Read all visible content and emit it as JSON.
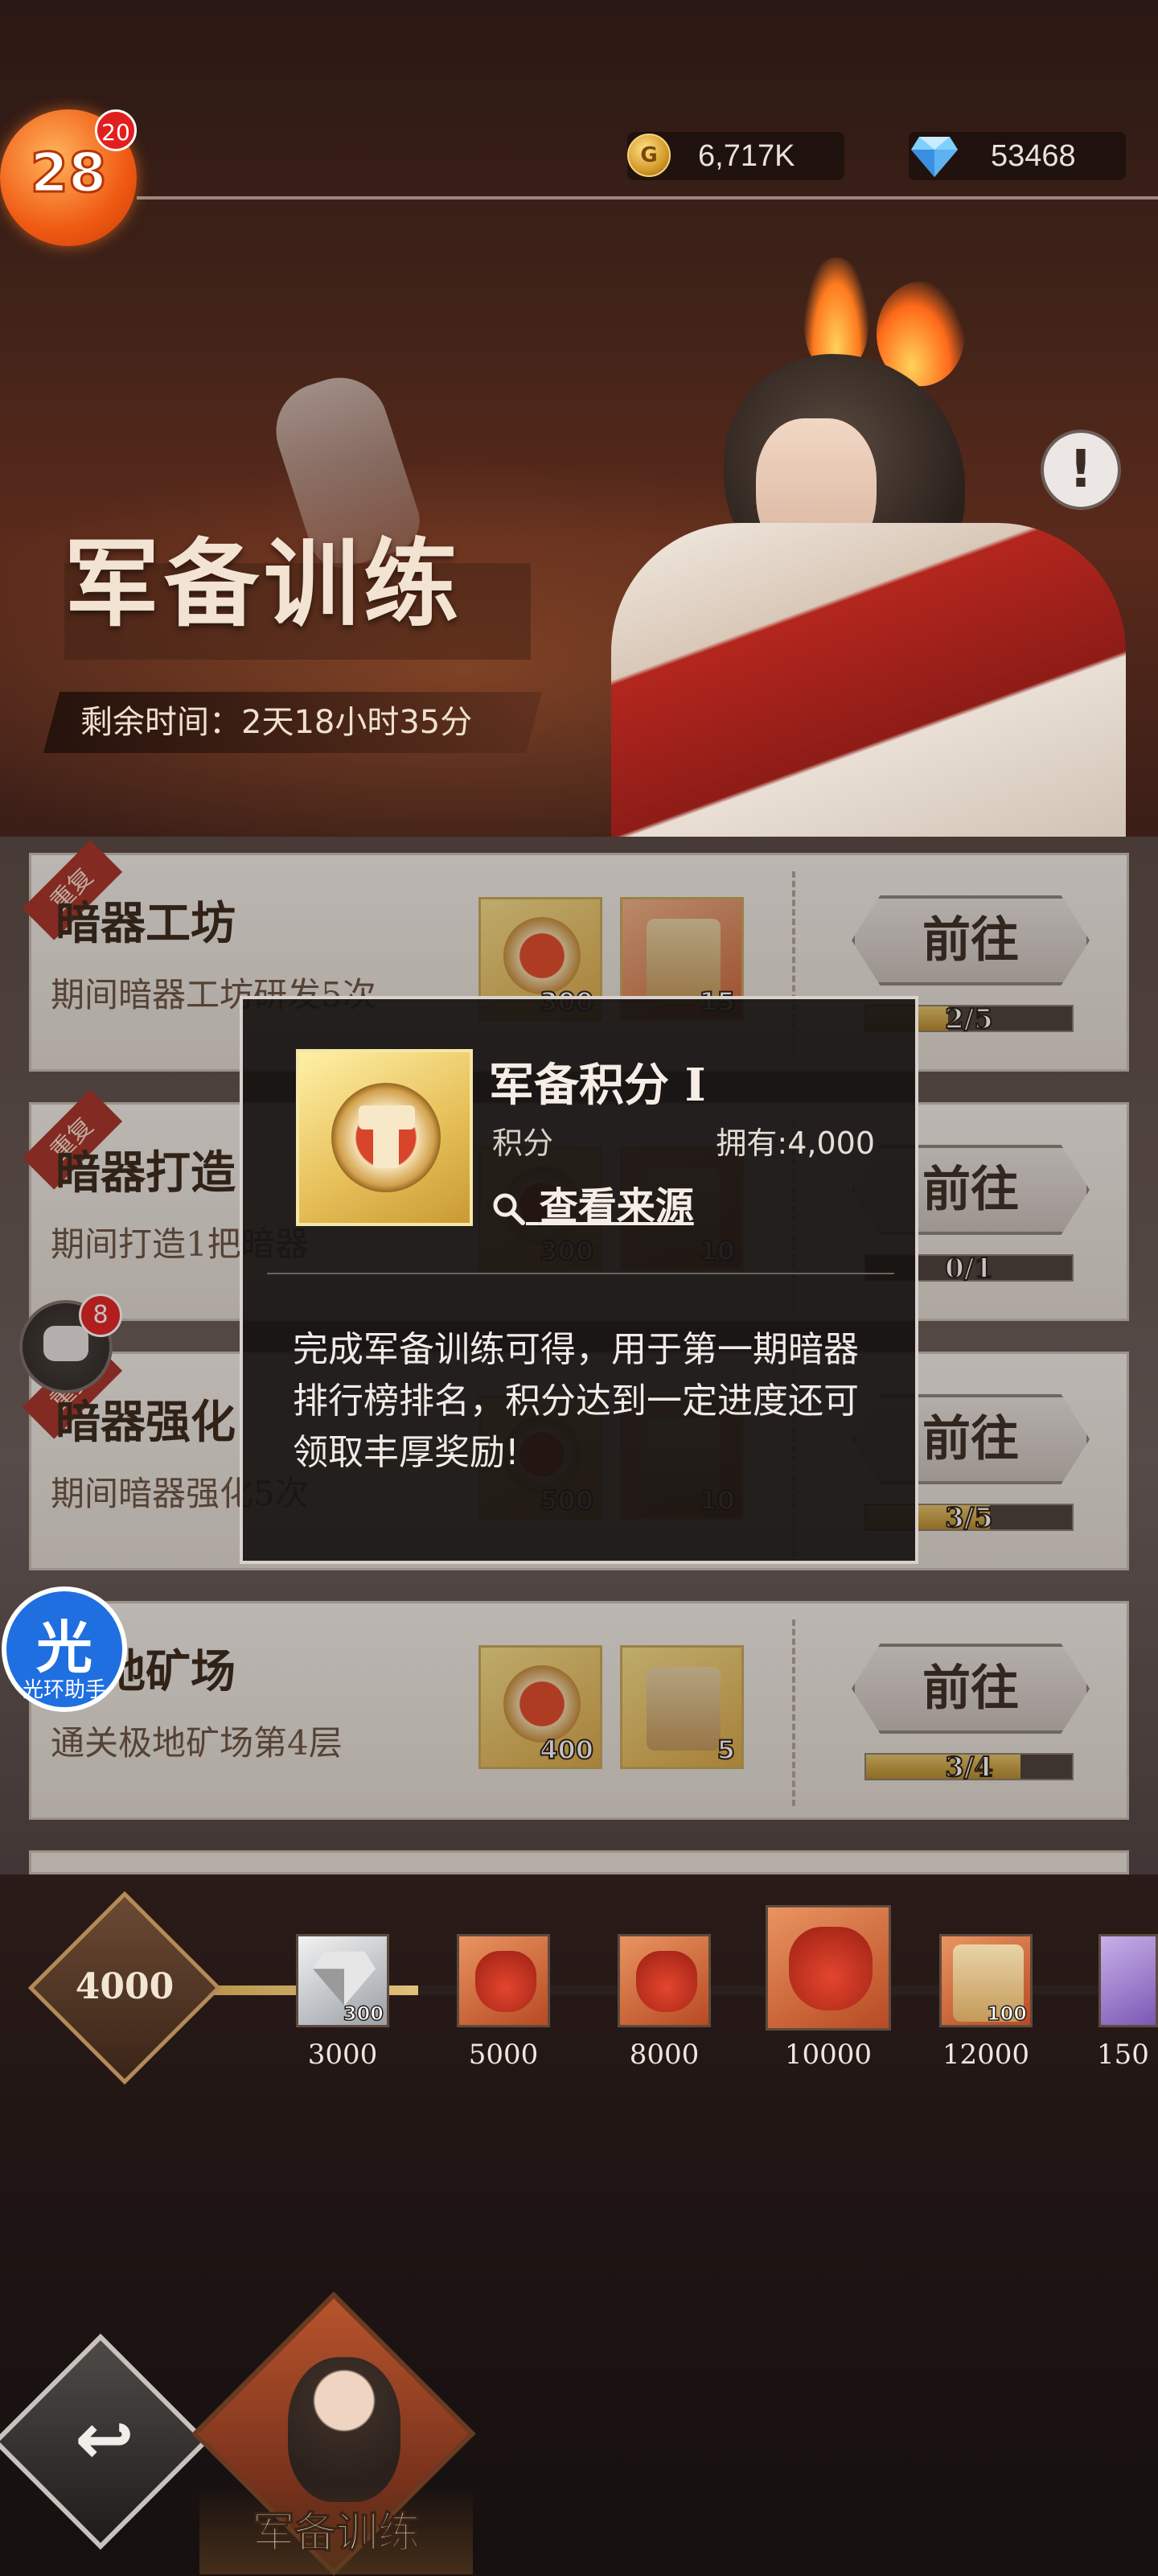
{
  "header": {
    "level": "28",
    "level_badge": "20",
    "gold": "6,717K",
    "gems": "53468"
  },
  "event": {
    "title": "军备训练",
    "time_remaining": "剩余时间：2天18小时35分"
  },
  "tasks": [
    {
      "tag": "重复",
      "title": "暗器工坊",
      "desc": "期间暗器工坊研发5次",
      "rewards": [
        "300",
        "15"
      ],
      "button": "前往",
      "progress": "2/5",
      "progress_value": 0.4
    },
    {
      "tag": "重复",
      "title": "暗器打造",
      "desc": "期间打造1把暗器",
      "rewards": [
        "300",
        "10"
      ],
      "button": "前往",
      "progress": "0/1",
      "progress_value": 0.0
    },
    {
      "tag": "重复",
      "title": "暗器强化",
      "desc": "期间暗器强化5次",
      "rewards": [
        "500",
        "10"
      ],
      "button": "前往",
      "progress": "3/5",
      "progress_value": 0.6
    },
    {
      "tag": "",
      "title": "极地矿场",
      "desc": "通关极地矿场第4层",
      "rewards": [
        "400",
        "5"
      ],
      "button": "前往",
      "progress": "3/4",
      "progress_value": 0.75
    }
  ],
  "popup": {
    "title": "军备积分 I",
    "type": "积分",
    "owned": "拥有:4,000",
    "link": "查看来源",
    "description": "完成军备训练可得，用于第一期暗器排行榜排名，积分达到一定进度还可领取丰厚奖励!"
  },
  "floating": {
    "chat_badge": "8",
    "helper_char": "光",
    "helper_label": "光环助手"
  },
  "track": {
    "current_score": "4000",
    "milestones": [
      {
        "label": "3000",
        "count": "300"
      },
      {
        "label": "5000",
        "count": ""
      },
      {
        "label": "8000",
        "count": ""
      },
      {
        "label": "10000",
        "count": ""
      },
      {
        "label": "12000",
        "count": "100"
      },
      {
        "label": "150",
        "count": ""
      }
    ]
  },
  "nav": {
    "tab_label": "军备训练"
  },
  "icons": {
    "gold": "gold-coin-icon",
    "gems": "diamond-icon",
    "info": "exclamation-icon",
    "search": "magnifier-icon",
    "back": "back-arrow-icon",
    "chat": "chat-bubble-icon"
  },
  "colors": {
    "accent": "#f05a13",
    "gold": "#d49b2a",
    "progress": "#e5c56b",
    "ribbon": "#a9352a"
  }
}
